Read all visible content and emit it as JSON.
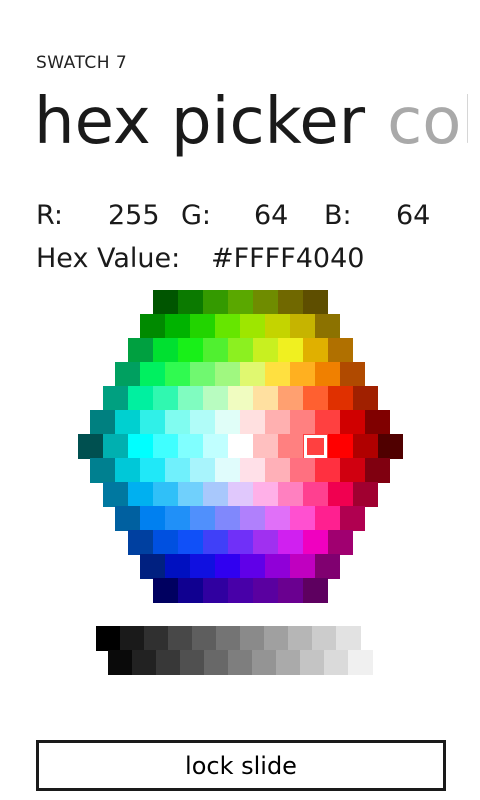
{
  "app_title": "SWATCH 7",
  "pivot": {
    "active": "hex picker",
    "inactive": "colo"
  },
  "rgb": {
    "r_label": "R:",
    "r_value": "255",
    "g_label": "G:",
    "g_value": "64",
    "b_label": "B:",
    "b_value": "64"
  },
  "hex": {
    "label": "Hex Value:",
    "value": "#FFFF4040"
  },
  "selected_color": "#FF4040",
  "hex_grid": [
    [
      "#005500",
      "#0B7A00",
      "#349A00",
      "#5AA800",
      "#6F8C00",
      "#706800",
      "#5E4E00"
    ],
    [
      "#008A00",
      "#00B300",
      "#22D400",
      "#66E600",
      "#9EE600",
      "#C4D400",
      "#C6B400",
      "#8C7200"
    ],
    [
      "#00A040",
      "#00E030",
      "#18F018",
      "#50F030",
      "#8CF020",
      "#C8F020",
      "#F0F020",
      "#E0B000",
      "#B07000"
    ],
    [
      "#00A060",
      "#00F060",
      "#30FA50",
      "#70F870",
      "#A0F880",
      "#E0F870",
      "#FFE040",
      "#FFB020",
      "#F08000",
      "#B04A00"
    ],
    [
      "#00A080",
      "#00F0A0",
      "#30F8B0",
      "#80FCC0",
      "#B8FCC0",
      "#F0FCC0",
      "#FFE0A0",
      "#FFA070",
      "#FF6030",
      "#E03000",
      "#A02000"
    ],
    [
      "#008080",
      "#00D0D0",
      "#30F0E8",
      "#80FCF0",
      "#B0FCF8",
      "#E0FEF8",
      "#FFE0E0",
      "#FFB0B0",
      "#FF8080",
      "#FF4040",
      "#D00000",
      "#800000"
    ],
    [
      "#005050",
      "#00B0B0",
      "#00FFFF",
      "#40FFFF",
      "#80FFFF",
      "#C0FFFF",
      "#FFFFFF",
      "#FFC0C0",
      "#FF8080",
      "#FF4040",
      "#FF0000",
      "#B00000",
      "#500000"
    ],
    [
      "#008090",
      "#00C8D8",
      "#20E8F8",
      "#70F0FC",
      "#A8F4FC",
      "#E0FCFC",
      "#FFE0E8",
      "#FFB0B8",
      "#FF7080",
      "#FF3040",
      "#D00010",
      "#800010"
    ],
    [
      "#0078A0",
      "#00B0F0",
      "#30C0F8",
      "#70D0FC",
      "#A8C8FC",
      "#E0C8FC",
      "#FFB0E8",
      "#FF80C0",
      "#FF4090",
      "#F00050",
      "#A00030"
    ],
    [
      "#0060A0",
      "#0080F0",
      "#2090F8",
      "#5090FC",
      "#8088FC",
      "#B080FC",
      "#E070F8",
      "#FF50D0",
      "#FF2090",
      "#B00050"
    ],
    [
      "#0040A0",
      "#0050E0",
      "#1050F8",
      "#4040F8",
      "#7030F8",
      "#A030F0",
      "#D020F0",
      "#F000C0",
      "#A00070"
    ],
    [
      "#002080",
      "#0010C0",
      "#1010E0",
      "#3000F0",
      "#6000E8",
      "#9000D8",
      "#C000C0",
      "#800070"
    ],
    [
      "#000060",
      "#100090",
      "#3000A0",
      "#4800A8",
      "#5A00A0",
      "#6A0090",
      "#5E0060"
    ]
  ],
  "greyscale": [
    [
      "#000000",
      "#1A1A1A",
      "#303030",
      "#484848",
      "#5E5E5E",
      "#747474",
      "#8A8A8A",
      "#A0A0A0",
      "#B6B6B6",
      "#CCCCCC",
      "#E2E2E2"
    ],
    [
      "#0A0A0A",
      "#222222",
      "#383838",
      "#505050",
      "#686868",
      "#7E7E7E",
      "#949494",
      "#AAAAAA",
      "#C4C4C4",
      "#DADADA",
      "#F0F0F0"
    ]
  ],
  "lock_button": "lock slide"
}
